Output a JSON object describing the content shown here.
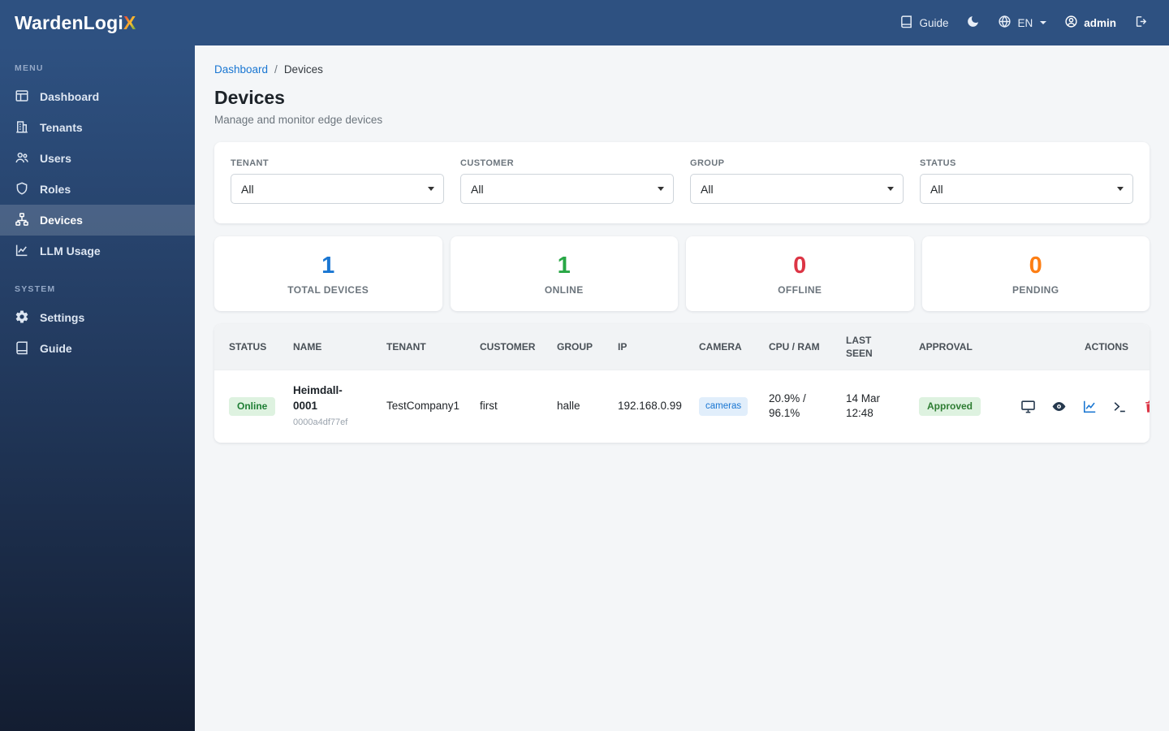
{
  "app": {
    "brand_prefix": "WardenLogi",
    "brand_suffix": "X"
  },
  "topbar": {
    "guide_label": "Guide",
    "language": "EN",
    "username": "admin"
  },
  "sidebar": {
    "menu_label": "MENU",
    "system_label": "SYSTEM",
    "menu_items": [
      {
        "label": "Dashboard"
      },
      {
        "label": "Tenants"
      },
      {
        "label": "Users"
      },
      {
        "label": "Roles"
      },
      {
        "label": "Devices"
      },
      {
        "label": "LLM Usage"
      }
    ],
    "system_items": [
      {
        "label": "Settings"
      },
      {
        "label": "Guide"
      }
    ]
  },
  "breadcrumb": {
    "parent": "Dashboard",
    "separator": "/",
    "current": "Devices"
  },
  "page": {
    "title": "Devices",
    "subtitle": "Manage and monitor edge devices"
  },
  "filters": [
    {
      "label": "TENANT",
      "value": "All"
    },
    {
      "label": "CUSTOMER",
      "value": "All"
    },
    {
      "label": "GROUP",
      "value": "All"
    },
    {
      "label": "STATUS",
      "value": "All"
    }
  ],
  "stats": [
    {
      "value": "1",
      "label": "TOTAL DEVICES",
      "color": "#1976d2"
    },
    {
      "value": "1",
      "label": "ONLINE",
      "color": "#28a745"
    },
    {
      "value": "0",
      "label": "OFFLINE",
      "color": "#dc3545"
    },
    {
      "value": "0",
      "label": "PENDING",
      "color": "#fd7e14"
    }
  ],
  "table": {
    "headers": [
      "STATUS",
      "NAME",
      "TENANT",
      "CUSTOMER",
      "GROUP",
      "IP",
      "CAMERA",
      "CPU / RAM",
      "LAST SEEN",
      "APPROVAL",
      "ACTIONS"
    ],
    "rows": [
      {
        "status": "Online",
        "name": "Heimdall-0001",
        "device_id": "0000a4df77ef",
        "tenant": "TestCompany1",
        "customer": "first",
        "group": "halle",
        "ip": "192.168.0.99",
        "camera_badge": "cameras",
        "cpu_ram": "20.9% / 96.1%",
        "last_seen": "14 Mar 12:48",
        "approval": "Approved"
      }
    ]
  },
  "colors": {
    "primary": "#1976d2",
    "success": "#28a745",
    "danger": "#dc3545",
    "warning": "#fd7e14"
  }
}
